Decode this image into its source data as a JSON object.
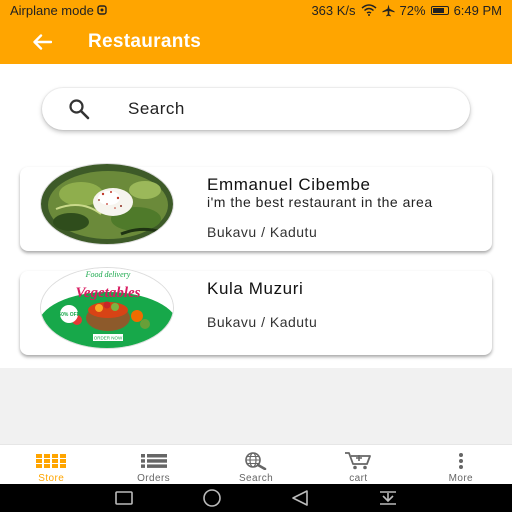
{
  "status_bar": {
    "left_text": "Airplane mode",
    "speed": "363 K/s",
    "battery": "72%",
    "time": "6:49 PM"
  },
  "app_bar": {
    "title": "Restaurants",
    "back_icon": "arrow-left-icon"
  },
  "search": {
    "placeholder": "Search",
    "value": "",
    "icon": "search-icon"
  },
  "restaurants": [
    {
      "name": "Emmanuel Cibembe",
      "description": "i'm the best restaurant in the area",
      "location": "Bukavu / Kadutu"
    },
    {
      "name": "Kula Muzuri",
      "description": "",
      "location": "Bukavu / Kadutu",
      "image_text": {
        "top": "Food delivery",
        "headline": "Vegetables",
        "button": "ORDER NOW",
        "badge": "50% OFF"
      }
    }
  ],
  "bottom_nav": [
    {
      "label": "Store",
      "icon": "store-grid-icon",
      "active": true
    },
    {
      "label": "Orders",
      "icon": "list-icon",
      "active": false
    },
    {
      "label": "Search",
      "icon": "globe-search-icon",
      "active": false
    },
    {
      "label": "cart",
      "icon": "cart-icon",
      "active": false
    },
    {
      "label": "More",
      "icon": "more-vertical-icon",
      "active": false
    }
  ],
  "colors": {
    "primary": "#ffa500",
    "background_grey": "#f1f1f1",
    "text": "#222222"
  }
}
